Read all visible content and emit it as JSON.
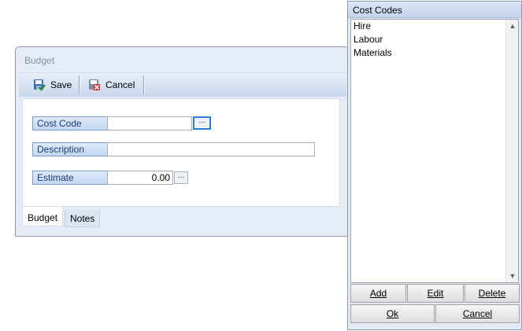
{
  "budget_window": {
    "title": "Budget",
    "toolbar": {
      "save_label": "Save",
      "cancel_label": "Cancel"
    },
    "fields": {
      "cost_code": {
        "label": "Cost Code",
        "value": "",
        "button": "..."
      },
      "description": {
        "label": "Description",
        "value": ""
      },
      "estimate": {
        "label": "Estimate",
        "value": "0.00",
        "button": "..."
      }
    },
    "tabs": [
      {
        "label": "Budget",
        "selected": true
      },
      {
        "label": "Notes",
        "selected": false
      }
    ]
  },
  "cost_codes_window": {
    "title": "Cost Codes",
    "items": [
      "Hire",
      "Labour",
      "Materials"
    ],
    "buttons": {
      "add": "Add",
      "edit": "Edit",
      "delete": "Delete",
      "ok": "Ok",
      "cancel": "Cancel"
    }
  },
  "colors": {
    "accent": "#2c7bd6",
    "label_text": "#1a3d73",
    "save_icon": "#2e8b3a",
    "cancel_icon": "#d22b2b"
  }
}
